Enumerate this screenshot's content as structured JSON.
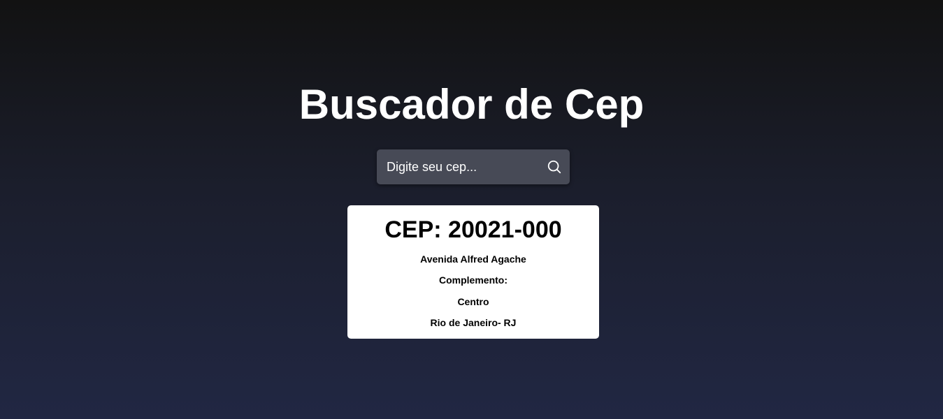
{
  "app": {
    "title": "Buscador de Cep"
  },
  "search": {
    "placeholder": "Digite seu cep...",
    "value": "",
    "button_icon": "search-icon"
  },
  "result": {
    "cep_line": "CEP: 20021-000",
    "logradouro": "Avenida Alfred Agache",
    "complemento": "Complemento:",
    "bairro": "Centro",
    "cidade_uf": "Rio de Janeiro- RJ"
  },
  "colors": {
    "background_top": "#121212",
    "background_bottom": "#212743",
    "search_background": "#474a56",
    "card_background": "#ffffff",
    "text_light": "#ffffff",
    "text_dark": "#000000"
  }
}
